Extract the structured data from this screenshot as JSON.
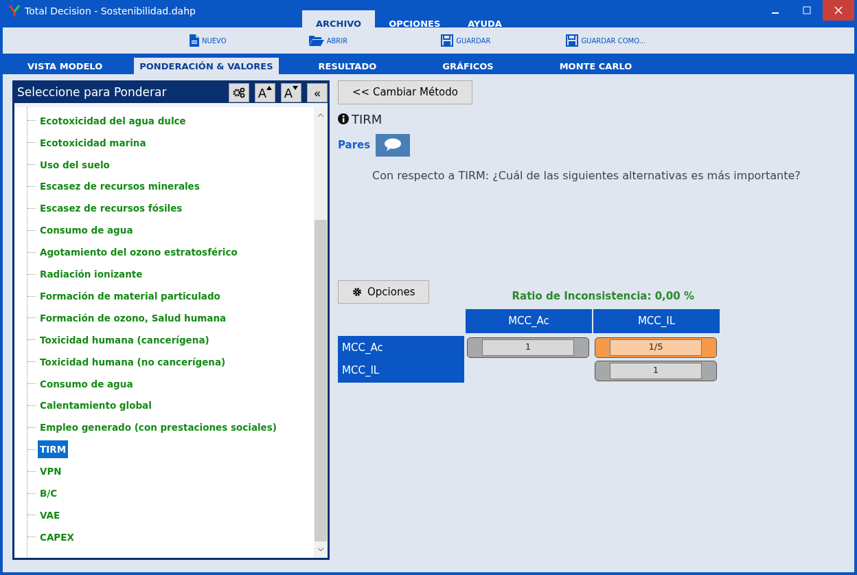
{
  "window": {
    "title": "Total Decision - Sostenibilidad.dahp"
  },
  "menu_tabs": [
    {
      "label": "ARCHIVO",
      "selected": true
    },
    {
      "label": "OPCIONES",
      "selected": false
    },
    {
      "label": "AYUDA",
      "selected": false
    }
  ],
  "toolbar": [
    {
      "label": "NUEVO",
      "kind": "new"
    },
    {
      "label": "ABRIR",
      "kind": "open"
    },
    {
      "label": "GUARDAR",
      "kind": "save"
    },
    {
      "label": "GUARDAR COMO...",
      "kind": "save"
    }
  ],
  "view_tabs": [
    {
      "label": "VISTA MODELO",
      "selected": false
    },
    {
      "label": "PONDERACIÓN & VALORES",
      "selected": true
    },
    {
      "label": "RESULTADO",
      "selected": false
    },
    {
      "label": "GRÁFICOS",
      "selected": false
    },
    {
      "label": "MONTE CARLO",
      "selected": false
    }
  ],
  "sidebar": {
    "title": "Seleccione para Ponderar",
    "tools": [
      {
        "kind": "gears"
      },
      {
        "kind": "font-up",
        "label": "A"
      },
      {
        "kind": "font-down",
        "label": "A"
      },
      {
        "kind": "collapse",
        "label": "«"
      }
    ],
    "items": [
      {
        "label": "Ecotoxicidad del agua dulce",
        "selected": false
      },
      {
        "label": "Ecotoxicidad marina",
        "selected": false
      },
      {
        "label": "Uso del suelo",
        "selected": false
      },
      {
        "label": "Escasez de recursos minerales",
        "selected": false
      },
      {
        "label": "Escasez de recursos fósiles",
        "selected": false
      },
      {
        "label": "Consumo de agua",
        "selected": false
      },
      {
        "label": "Agotamiento del ozono estratosférico",
        "selected": false
      },
      {
        "label": "Radiación ionizante",
        "selected": false
      },
      {
        "label": "Formación de material particulado",
        "selected": false
      },
      {
        "label": "Formación de ozono, Salud humana",
        "selected": false
      },
      {
        "label": "Toxicidad humana (cancerígena)",
        "selected": false
      },
      {
        "label": "Toxicidad humana (no cancerígena)",
        "selected": false
      },
      {
        "label": "Consumo de agua",
        "selected": false
      },
      {
        "label": "Calentamiento global",
        "selected": false
      },
      {
        "label": "Empleo generado (con prestaciones sociales)",
        "selected": false
      },
      {
        "label": "TIRM",
        "selected": true
      },
      {
        "label": "VPN",
        "selected": false
      },
      {
        "label": "B/C",
        "selected": false
      },
      {
        "label": "VAE",
        "selected": false
      },
      {
        "label": "CAPEX",
        "selected": false
      }
    ]
  },
  "main": {
    "back_button": "<< Cambiar Método",
    "criterion": "TIRM",
    "mode_label": "Pares",
    "question": "Con respecto a TIRM: ¿Cuál de las siguientes alternativas es más importante?",
    "options_button": "Opciones",
    "inconsistency": "Ratio de Inconsistencia: 0,00 %",
    "matrix": {
      "columns": [
        "MCC_Ac",
        "MCC_IL"
      ],
      "rows": [
        {
          "label": "MCC_Ac",
          "cells": [
            {
              "value": "1",
              "kind": "equal"
            },
            {
              "value": "1/5",
              "kind": "preferred"
            }
          ]
        },
        {
          "label": "MCC_IL",
          "cells": [
            null,
            {
              "value": "1",
              "kind": "equal"
            }
          ]
        }
      ]
    }
  }
}
